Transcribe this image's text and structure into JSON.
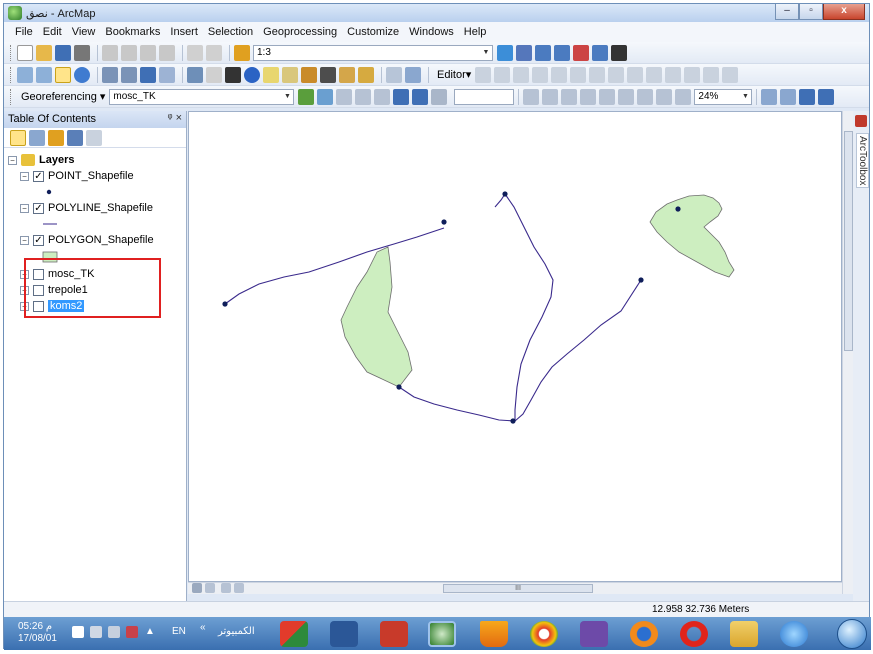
{
  "window": {
    "title": "نصق - ArcMap",
    "controls": [
      "–",
      "▫",
      "x"
    ]
  },
  "menu": [
    "File",
    "Edit",
    "View",
    "Bookmarks",
    "Insert",
    "Selection",
    "Geoprocessing",
    "Customize",
    "Windows",
    "Help"
  ],
  "toolbar": {
    "scale": "1:3",
    "editor_label": "Editor▾",
    "georef_label": "Georeferencing ▾",
    "georef_layer": "mosc_TK",
    "transparency": "24%"
  },
  "toc": {
    "title": "Table Of Contents",
    "pin": "ᵠ ×",
    "root": "Layers",
    "layers": [
      {
        "name": "POINT_Shapefile",
        "checked": true,
        "expanded": true,
        "symbol": "point"
      },
      {
        "name": "POLYLINE_Shapefile",
        "checked": true,
        "expanded": true,
        "symbol": "line"
      },
      {
        "name": "POLYGON_Shapefile",
        "checked": true,
        "expanded": true,
        "symbol": "polygon"
      },
      {
        "name": "mosc_TK",
        "checked": false,
        "expanded": false
      },
      {
        "name": "trepole1",
        "checked": false,
        "expanded": false
      },
      {
        "name": "koms2",
        "checked": false,
        "expanded": false,
        "selected": true
      }
    ]
  },
  "side_tab": {
    "label": "ArcToolbox"
  },
  "status": {
    "coords": "12.958  32.736 Meters"
  },
  "map_colors": {
    "polygon_fill": "#cdeec0",
    "polygon_stroke": "#6e6e6e",
    "line": "#3a2a8c",
    "point": "#0f1e5a"
  },
  "taskbar": {
    "time": "05:26 م",
    "date": "17/08/01",
    "lang": "EN",
    "chevron": "«",
    "keyboard_label": "الكمبيوتر"
  }
}
